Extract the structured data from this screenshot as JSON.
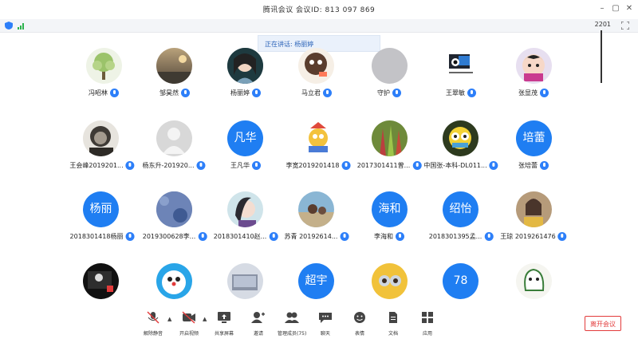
{
  "window": {
    "title": "腾讯会议 会议ID: 813 097 869"
  },
  "meeting": {
    "timer": "2201",
    "speaking": "正在讲话: 杨丽婷"
  },
  "participants": {
    "r1": [
      "冯昭林",
      "邹昊然",
      "杨丽婷",
      "马立君",
      "守护",
      "王翠敏",
      "张显茂"
    ],
    "r2": [
      "王会峰2019201...",
      "杨东升-201920...",
      "王凡华",
      "李宽2019201418",
      "2017301411曾...",
      "中国张-本科-DL011...",
      "张培蕾"
    ],
    "r3": [
      "2018301418杨丽",
      "2019300628李...",
      "2018301410赵...",
      "苏青 20192614...",
      "李海和",
      "2018301395孟...",
      "王琼 2019261476"
    ],
    "r4": [
      "",
      "",
      "",
      "",
      "",
      "",
      ""
    ],
    "initials": {
      "fanhua": "凡华",
      "peilei": "培蕾",
      "yangli": "杨丽",
      "haihe": "海和",
      "shaoyi": "绍怡",
      "chaoyu": "超宇",
      "n78": "78"
    }
  },
  "toolbar": {
    "mute": "解除静音",
    "video": "开启视频",
    "share": "共享屏幕",
    "invite": "邀请",
    "members": "管理成员(75)",
    "chat": "聊天",
    "reactions": "表情",
    "docs": "文档",
    "apps": "应用"
  },
  "leave": "离开会议"
}
